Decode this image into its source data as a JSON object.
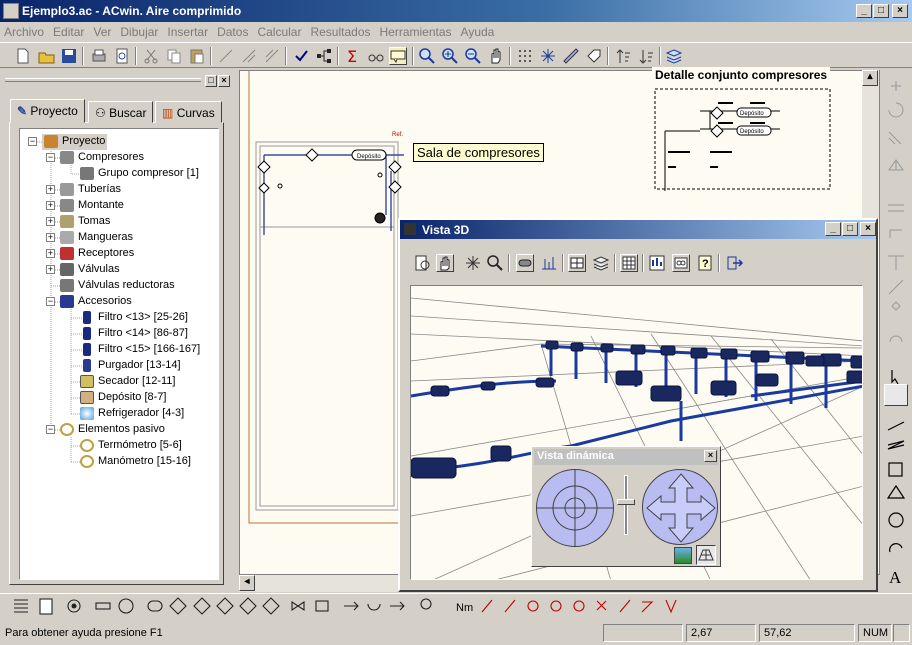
{
  "window": {
    "title": "Ejemplo3.ac - ACwin. Aire comprimido",
    "min": "_",
    "max": "□",
    "close": "×"
  },
  "menu": [
    "Archivo",
    "Editar",
    "Ver",
    "Dibujar",
    "Insertar",
    "Datos",
    "Calcular",
    "Resultados",
    "Herramientas",
    "Ayuda"
  ],
  "panel": {
    "tabs": [
      "Proyecto",
      "Buscar",
      "Curvas"
    ]
  },
  "tree": {
    "root": "Proyecto",
    "items": [
      {
        "label": "Compresores",
        "expanded": true,
        "children": [
          "Grupo compresor [1]"
        ]
      },
      {
        "label": "Tuberías"
      },
      {
        "label": "Montante"
      },
      {
        "label": "Tomas"
      },
      {
        "label": "Mangueras"
      },
      {
        "label": "Receptores"
      },
      {
        "label": "Válvulas"
      },
      {
        "label": "Válvulas reductoras"
      },
      {
        "label": "Accesorios",
        "expanded": true,
        "children": [
          "Filtro <13> [25-26]",
          "Filtro <14> [86-87]",
          "Filtro <15> [166-167]",
          "Purgador [13-14]",
          "Secador [12-11]",
          "Depósito [8-7]",
          "Refrigerador [4-3]"
        ]
      },
      {
        "label": "Elementos pasivo",
        "expanded": true,
        "children": [
          "Termómetro [5-6]",
          "Manómetro [15-16]"
        ]
      }
    ]
  },
  "canvas": {
    "label_sala": "Sala de compresores",
    "label_detalle": "Detalle conjunto compresores",
    "deposito": "Depósito",
    "ref": "Ref."
  },
  "vista3d": {
    "title": "Vista 3D"
  },
  "vista_dinamica": {
    "title": "Vista dinámica"
  },
  "bottom_tools": {
    "nm": "Nm"
  },
  "status": {
    "help": "Para obtener ayuda presione F1",
    "x": "2,67",
    "y": "57,62",
    "num": "NUM"
  }
}
